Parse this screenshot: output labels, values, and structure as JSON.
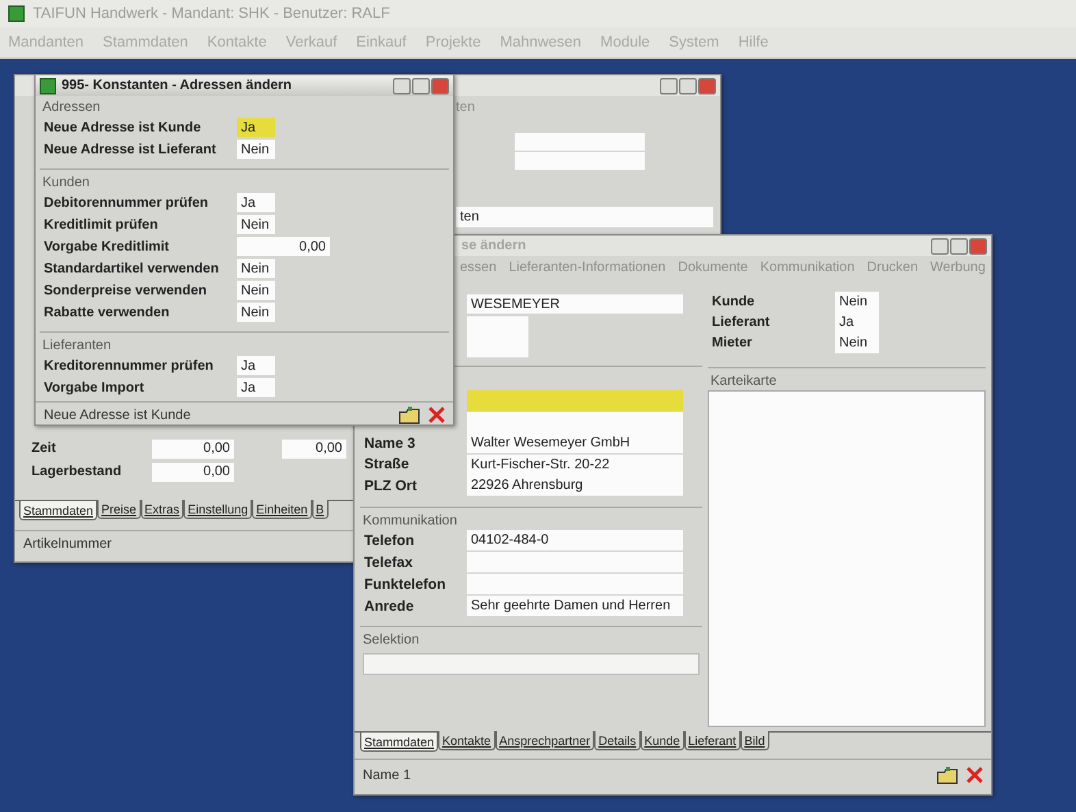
{
  "app": {
    "title": "TAIFUN Handwerk - Mandant: SHK - Benutzer: RALF",
    "menu": [
      "Mandanten",
      "Stammdaten",
      "Kontakte",
      "Verkauf",
      "Einkauf",
      "Projekte",
      "Mahnwesen",
      "Module",
      "System",
      "Hilfe"
    ]
  },
  "article_window": {
    "active": false,
    "menu_fragment": "ten",
    "field_fragment": "ten",
    "rows": [
      {
        "label": "Zeit",
        "values": [
          "0,00",
          "0,00"
        ]
      },
      {
        "label": "Lagerbestand",
        "values": [
          "0,00"
        ]
      }
    ],
    "tabs": [
      {
        "label": "Stammdaten",
        "selected": true
      },
      {
        "label": "Preise",
        "selected": false
      },
      {
        "label": "Extras",
        "selected": false
      },
      {
        "label": "Einstellung",
        "selected": false
      },
      {
        "label": "Einheiten",
        "selected": false
      },
      {
        "label": "B",
        "selected": false
      }
    ],
    "status": "Artikelnummer"
  },
  "constants_window": {
    "active": true,
    "title": "995- Konstanten - Adressen ändern",
    "groups": [
      {
        "title": "Adressen",
        "rows": [
          {
            "label": "Neue Adresse ist Kunde",
            "value": "Ja",
            "kind": "choice",
            "focused": true
          },
          {
            "label": "Neue Adresse ist Lieferant",
            "value": "Nein",
            "kind": "choice",
            "focused": false
          }
        ]
      },
      {
        "title": "Kunden",
        "rows": [
          {
            "label": "Debitorennummer prüfen",
            "value": "Ja",
            "kind": "choice",
            "focused": false
          },
          {
            "label": "Kreditlimit prüfen",
            "value": "Nein",
            "kind": "choice",
            "focused": false
          },
          {
            "label": "Vorgabe Kreditlimit",
            "value": "0,00",
            "kind": "amount",
            "focused": false
          },
          {
            "label": "Standardartikel verwenden",
            "value": "Nein",
            "kind": "choice",
            "focused": false
          },
          {
            "label": "Sonderpreise verwenden",
            "value": "Nein",
            "kind": "choice",
            "focused": false
          },
          {
            "label": "Rabatte verwenden",
            "value": "Nein",
            "kind": "choice",
            "focused": false
          }
        ]
      },
      {
        "title": "Lieferanten",
        "rows": [
          {
            "label": "Kreditorennummer prüfen",
            "value": "Ja",
            "kind": "choice",
            "focused": false
          },
          {
            "label": "Vorgabe Import",
            "value": "Ja",
            "kind": "choice",
            "focused": false
          }
        ]
      }
    ],
    "status": "Neue Adresse ist Kunde"
  },
  "address_window": {
    "active": false,
    "title": "se ändern",
    "menu": [
      "essen",
      "Lieferanten-Informationen",
      "Dokumente",
      "Kommunikation",
      "Drucken",
      "Werbung"
    ],
    "search_name": "WESEMEYER",
    "flags": [
      {
        "label": "Kunde",
        "value": "Nein"
      },
      {
        "label": "Lieferant",
        "value": "Ja"
      },
      {
        "label": "Mieter",
        "value": "Nein"
      }
    ],
    "address": [
      {
        "focused": true
      },
      {
        "focused": false
      },
      {
        "label": "Name 3",
        "value": "Walter Wesemeyer GmbH",
        "focused": false
      },
      {
        "label": "Straße",
        "value": "Kurt-Fischer-Str. 20-22",
        "focused": false
      },
      {
        "label": "PLZ Ort",
        "value": "22926 Ahrensburg",
        "focused": false
      }
    ],
    "communication": {
      "title": "Kommunikation",
      "rows": [
        {
          "label": "Telefon",
          "value": "04102-484-0"
        },
        {
          "label": "Telefax"
        },
        {
          "label": "Funktelefon"
        },
        {
          "label": "Anrede",
          "value": "Sehr geehrte Damen und Herren"
        }
      ]
    },
    "selection_title": "Selektion",
    "card_title": "Karteikarte",
    "tabs": [
      {
        "label": "Stammdaten",
        "selected": true
      },
      {
        "label": "Kontakte",
        "selected": false
      },
      {
        "label": "Ansprechpartner",
        "selected": false
      },
      {
        "label": "Details",
        "selected": false
      },
      {
        "label": "Kunde",
        "selected": false
      },
      {
        "label": "Lieferant",
        "selected": false
      },
      {
        "label": "Bild",
        "selected": false
      }
    ],
    "status": "Name 1"
  }
}
